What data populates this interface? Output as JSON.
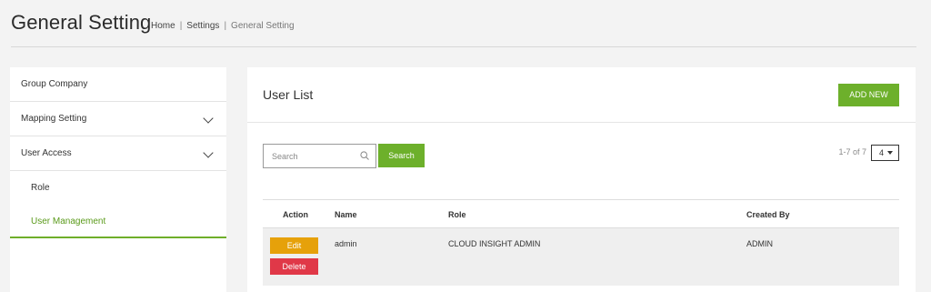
{
  "header": {
    "title": "General Setting",
    "breadcrumb": {
      "home": "Home",
      "settings": "Settings",
      "current": "General Setting",
      "separator": "|"
    }
  },
  "sidebar": {
    "items": [
      {
        "label": "Group Company"
      },
      {
        "label": "Mapping Setting"
      },
      {
        "label": "User Access"
      }
    ],
    "sub_items": [
      {
        "label": "Role"
      },
      {
        "label": "User Management"
      }
    ]
  },
  "main": {
    "title": "User List",
    "add_label": "ADD NEW",
    "search": {
      "placeholder": "Search",
      "value": "",
      "button_label": "Search"
    },
    "pager": {
      "summary": "1-7 of 7",
      "page_size": "4"
    },
    "table": {
      "headers": {
        "action": "Action",
        "name": "Name",
        "role": "Role",
        "created_by": "Created By"
      },
      "rows": [
        {
          "name": "admin",
          "role": "CLOUD INSIGHT ADMIN",
          "created_by": "ADMIN",
          "edit_label": "Edit",
          "delete_label": "Delete"
        }
      ]
    }
  },
  "colors": {
    "accent": "#6db02b",
    "edit": "#e6a10a",
    "delete": "#e03848"
  }
}
